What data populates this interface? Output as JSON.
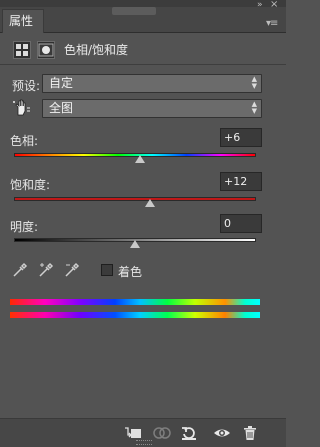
{
  "panel": {
    "tab_label": "属性",
    "title": "色相/饱和度"
  },
  "preset": {
    "label": "预设:",
    "value": "自定"
  },
  "range": {
    "value": "全图"
  },
  "hue": {
    "label": "色相:",
    "value": "+6",
    "slider_position": 0.52
  },
  "saturation": {
    "label": "饱和度:",
    "value": "+12",
    "slider_position": 0.56
  },
  "lightness": {
    "label": "明度:",
    "value": "0",
    "slider_position": 0.5
  },
  "colorize": {
    "label": "着色",
    "checked": false
  },
  "colors": {
    "panel_bg": "#535353",
    "saturation_track": "#c01818",
    "thumb": "#c9c9c9"
  },
  "icons": {
    "header": [
      "adjustment-layer-icon",
      "mask-icon"
    ],
    "targeted_adjustment": "hand-tool-icon",
    "eyedroppers": [
      "eyedropper-icon",
      "eyedropper-add-icon",
      "eyedropper-subtract-icon"
    ],
    "footer": [
      "clip-to-layer-icon",
      "view-previous-state-icon",
      "reset-icon",
      "visibility-eye-icon",
      "trash-icon"
    ]
  }
}
